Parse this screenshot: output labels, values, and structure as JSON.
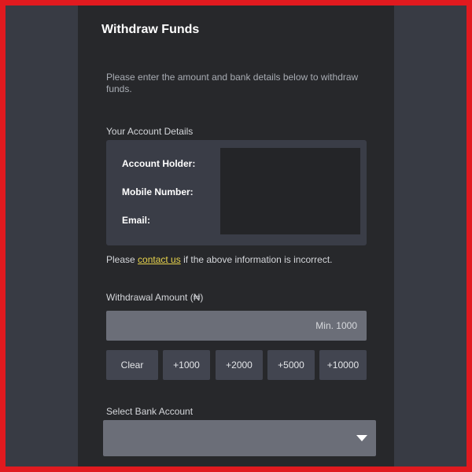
{
  "dialog": {
    "title": "Withdraw Funds",
    "intro": "Please enter the amount and bank details below to withdraw funds."
  },
  "account": {
    "section_label": "Your Account Details",
    "labels": {
      "holder": "Account Holder:",
      "mobile": "Mobile Number:",
      "email": "Email:"
    }
  },
  "note": {
    "before": "Please ",
    "link": "contact us",
    "after": " if the above information is incorrect."
  },
  "withdrawal": {
    "label": "Withdrawal Amount (₦)",
    "placeholder": "Min. 1000",
    "buttons": [
      "Clear",
      "+1000",
      "+2000",
      "+5000",
      "+10000"
    ]
  },
  "bank": {
    "label": "Select Bank Account",
    "selected": ""
  },
  "colors": {
    "frame_border": "#e01a1f",
    "link": "#e8d44d",
    "panel": "#27282b",
    "background": "#383b44"
  },
  "icons": {
    "select_caret": "chevron-down-icon"
  }
}
